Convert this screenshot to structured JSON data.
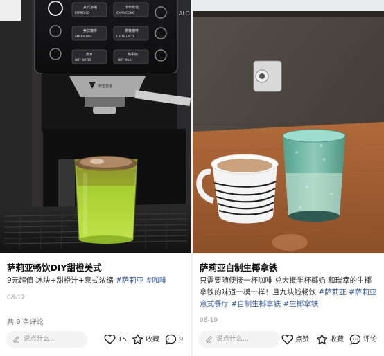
{
  "posts": [
    {
      "title": "萨莉亚畅饮DIY甜橙美式",
      "desc_lines": [
        [
          "9元超值 冰块+甜橙汁+意式浓缩 ",
          "#萨莉亚",
          " ",
          "#咖啡"
        ]
      ],
      "date": "08-12",
      "comments_total": "共 9 条评论",
      "comment_placeholder": "说点什么...",
      "likes": "15",
      "collect_label": "收藏",
      "comment_count": "9",
      "photo_text": {
        "btn1": "意式浓缩",
        "btn1_en": "ESPRESSO",
        "btn2": "卡布奇诺",
        "btn2_en": "CAPPUCCINO",
        "btn3": "美式咖啡",
        "btn3_en": "AMERICANO",
        "btn4": "拿铁咖啡",
        "btn4_en": "CAFFE LATTE",
        "btn5": "热水",
        "btn5_en": "HOT WATER",
        "btn6": "热牛奶",
        "btn6_en": "HOT MILK",
        "brand": "ALO",
        "nozzle": "杯垫放置"
      }
    },
    {
      "title": "萨莉亚自制生椰拿铁",
      "desc_lines": [
        [
          "只需要随便接一杯咖啡 兑大概半杯椰奶 和瑞幸的生椰"
        ],
        [
          "拿铁的味道一模一样！且九块钱畅饮 ",
          "#萨莉亚",
          " ",
          "#萨莉亚"
        ],
        [
          "意式餐厅",
          " ",
          "#自制生椰拿铁",
          " ",
          "#生椰拿铁"
        ]
      ],
      "date": "08-19",
      "comment_placeholder": "说点什么...",
      "like_label": "点赞",
      "collect_label": "收藏",
      "comment_label": "评论"
    }
  ],
  "colors": {
    "tag": "#3a5a99",
    "drink_green": "#a9d13a",
    "coconut_cup": "#5fb3a3"
  },
  "icons": [
    "pen-icon",
    "heart-icon",
    "star-icon",
    "comment-bubble-icon"
  ]
}
